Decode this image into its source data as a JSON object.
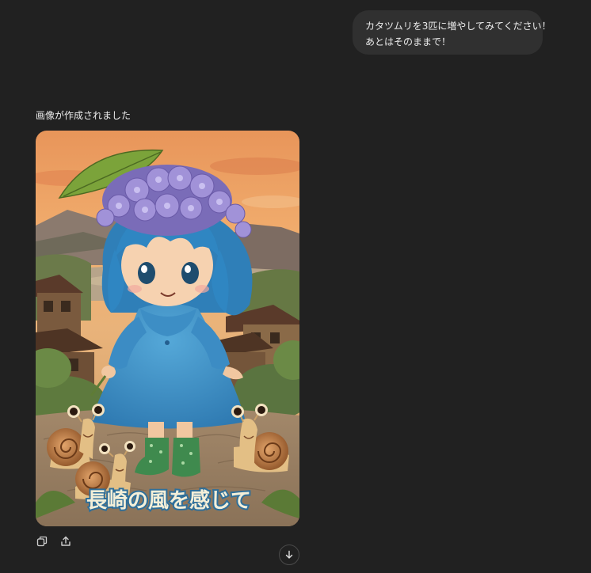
{
  "conversation": {
    "user_message": {
      "line1": "カタツムリを3匹に増やしてみてください！",
      "line2": "あとはそのままで！"
    },
    "assistant": {
      "status_text": "画像が作成されました",
      "image": {
        "caption_text": "長崎の風を感じて"
      }
    }
  },
  "actions": {
    "copy_icon": "copy-icon",
    "share_icon": "share-icon"
  },
  "scroll": {
    "icon": "arrow-down-icon"
  },
  "colors": {
    "background": "#212121",
    "bubble": "#303030",
    "text": "#ececec"
  }
}
